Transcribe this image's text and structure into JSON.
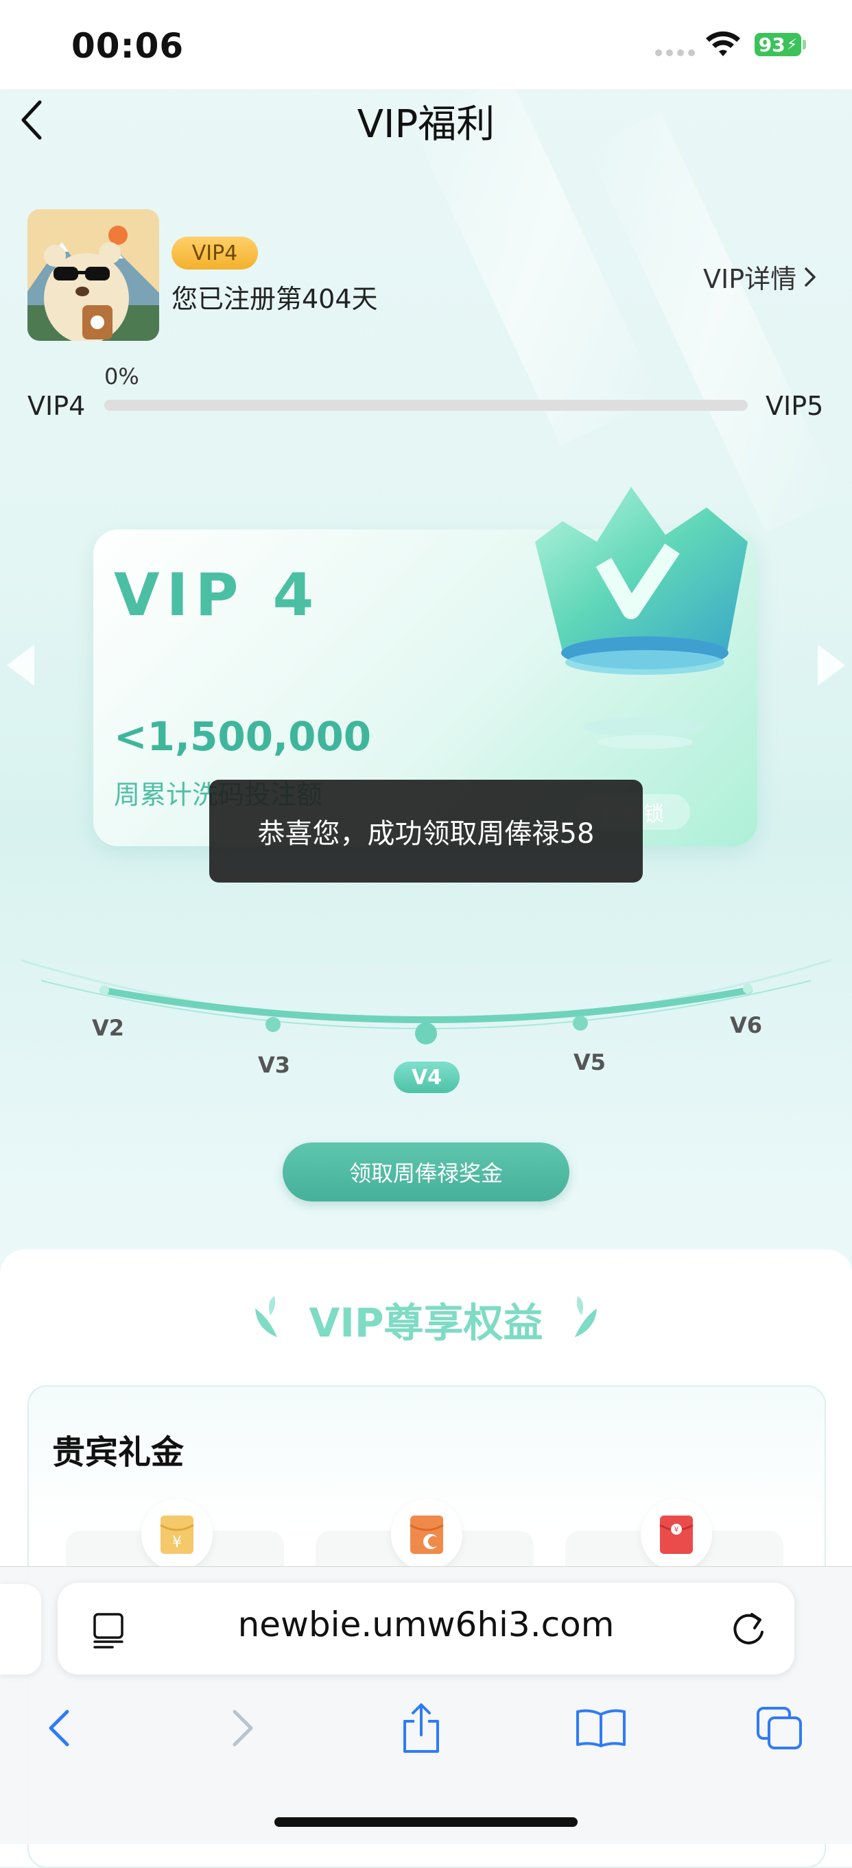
{
  "status_bar": {
    "time": "00:06",
    "battery": "93"
  },
  "header": {
    "title": "VIP福利",
    "back_icon": "chevron-left-icon"
  },
  "profile": {
    "vip_badge": "VIP4",
    "registered_text": "您已注册第404天",
    "detail_link": "VIP详情",
    "detail_icon": "chevron-right-icon"
  },
  "progress": {
    "percent_label": "0%",
    "percent_value": 0,
    "from_level": "VIP4",
    "to_level": "VIP5"
  },
  "vip_card": {
    "title": "VIP 4",
    "amount": "<1,500,000",
    "description": "周累计洗码投注额",
    "unlock_label": "已解锁"
  },
  "toast": {
    "message": "恭喜您，成功领取周俸禄58"
  },
  "level_arc": {
    "levels": [
      "V2",
      "V3",
      "V4",
      "V5",
      "V6"
    ],
    "active": "V4"
  },
  "claim_button": {
    "label": "领取周俸禄奖金"
  },
  "benefits": {
    "heading": "VIP尊享权益",
    "section_title": "贵宾礼金",
    "icons": [
      "gold-envelope-icon",
      "orange-envelope-icon",
      "red-envelope-icon"
    ]
  },
  "browser": {
    "url": "newbie.umw6hi3.com"
  },
  "colors": {
    "accent": "#4fbea5",
    "badge_gold": "#f3b12c",
    "toast_bg": "#1e1e1e",
    "battery": "#3cc25a"
  }
}
